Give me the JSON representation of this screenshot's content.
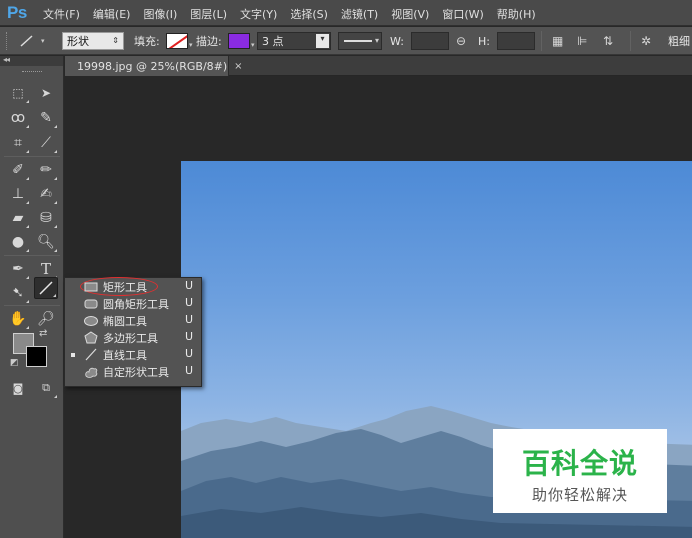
{
  "app": {
    "logo": "Ps"
  },
  "menu": [
    "文件(F)",
    "编辑(E)",
    "图像(I)",
    "图层(L)",
    "文字(Y)",
    "选择(S)",
    "滤镜(T)",
    "视图(V)",
    "窗口(W)",
    "帮助(H)"
  ],
  "options_bar": {
    "mode_value": "形状",
    "fill_label": "填充:",
    "stroke_label": "描边:",
    "stroke_color": "#8a2be2",
    "stroke_width_value": "3 点",
    "w_label": "W:",
    "h_label": "H:",
    "weight_label": "粗细"
  },
  "document_tab": {
    "title": "19998.jpg @ 25%(RGB/8#)",
    "close": "×"
  },
  "flyout": {
    "items": [
      {
        "label": "矩形工具",
        "key": "U",
        "icon": "rectangle-icon",
        "selected": false
      },
      {
        "label": "圆角矩形工具",
        "key": "U",
        "icon": "rounded-rectangle-icon",
        "selected": false
      },
      {
        "label": "椭圆工具",
        "key": "U",
        "icon": "ellipse-icon",
        "selected": false
      },
      {
        "label": "多边形工具",
        "key": "U",
        "icon": "polygon-icon",
        "selected": false
      },
      {
        "label": "直线工具",
        "key": "U",
        "icon": "line-icon",
        "selected": true
      },
      {
        "label": "自定形状工具",
        "key": "U",
        "icon": "custom-shape-icon",
        "selected": false
      }
    ]
  },
  "colors": {
    "foreground": "#8a8a8a",
    "background": "#000000",
    "highlight": "#e03030",
    "watermark_green": "#2bb34a"
  },
  "watermark": {
    "title": "百科全说",
    "subtitle": "助你轻松解决"
  }
}
